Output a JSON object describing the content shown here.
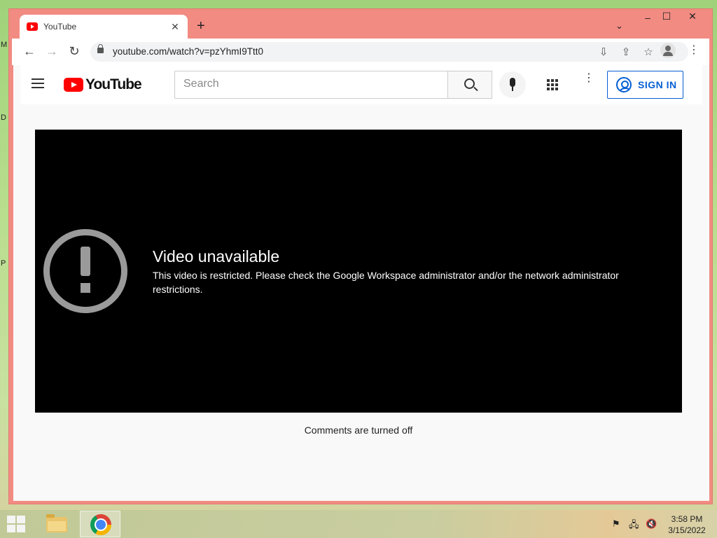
{
  "desktop": {
    "edge_glyphs": [
      "M",
      "D",
      "P"
    ]
  },
  "browser": {
    "tab": {
      "title": "YouTube",
      "close": "✕"
    },
    "new_tab": "+",
    "tab_search": "⌄",
    "window_controls": {
      "minimize": "–",
      "maximize": "☐",
      "close": "✕"
    },
    "toolbar": {
      "back": "←",
      "forward": "→",
      "reload": "↻",
      "url": "youtube.com/watch?v=pzYhmI9Ttt0",
      "install_icon": "⇩",
      "share_icon": "⇪",
      "bookmark_icon": "☆",
      "menu_icon": "⋮"
    }
  },
  "youtube": {
    "logo_text": "YouTube",
    "search": {
      "placeholder": "Search"
    },
    "more_icon": "⋮",
    "sign_in": "SIGN IN",
    "player": {
      "error_title": "Video unavailable",
      "error_message": "This video is restricted. Please check the Google Workspace administrator and/or the network administrator restrictions."
    },
    "comments_status": "Comments are turned off"
  },
  "taskbar": {
    "tray": {
      "flag_icon": "⚑",
      "network_icon": "🖧",
      "volume_icon": "🔇"
    },
    "clock": {
      "time": "3:58 PM",
      "date": "3/15/2022"
    }
  },
  "colors": {
    "window_frame": "#f28b82",
    "yt_red": "#ff0000",
    "signin_blue": "#065fd4"
  }
}
